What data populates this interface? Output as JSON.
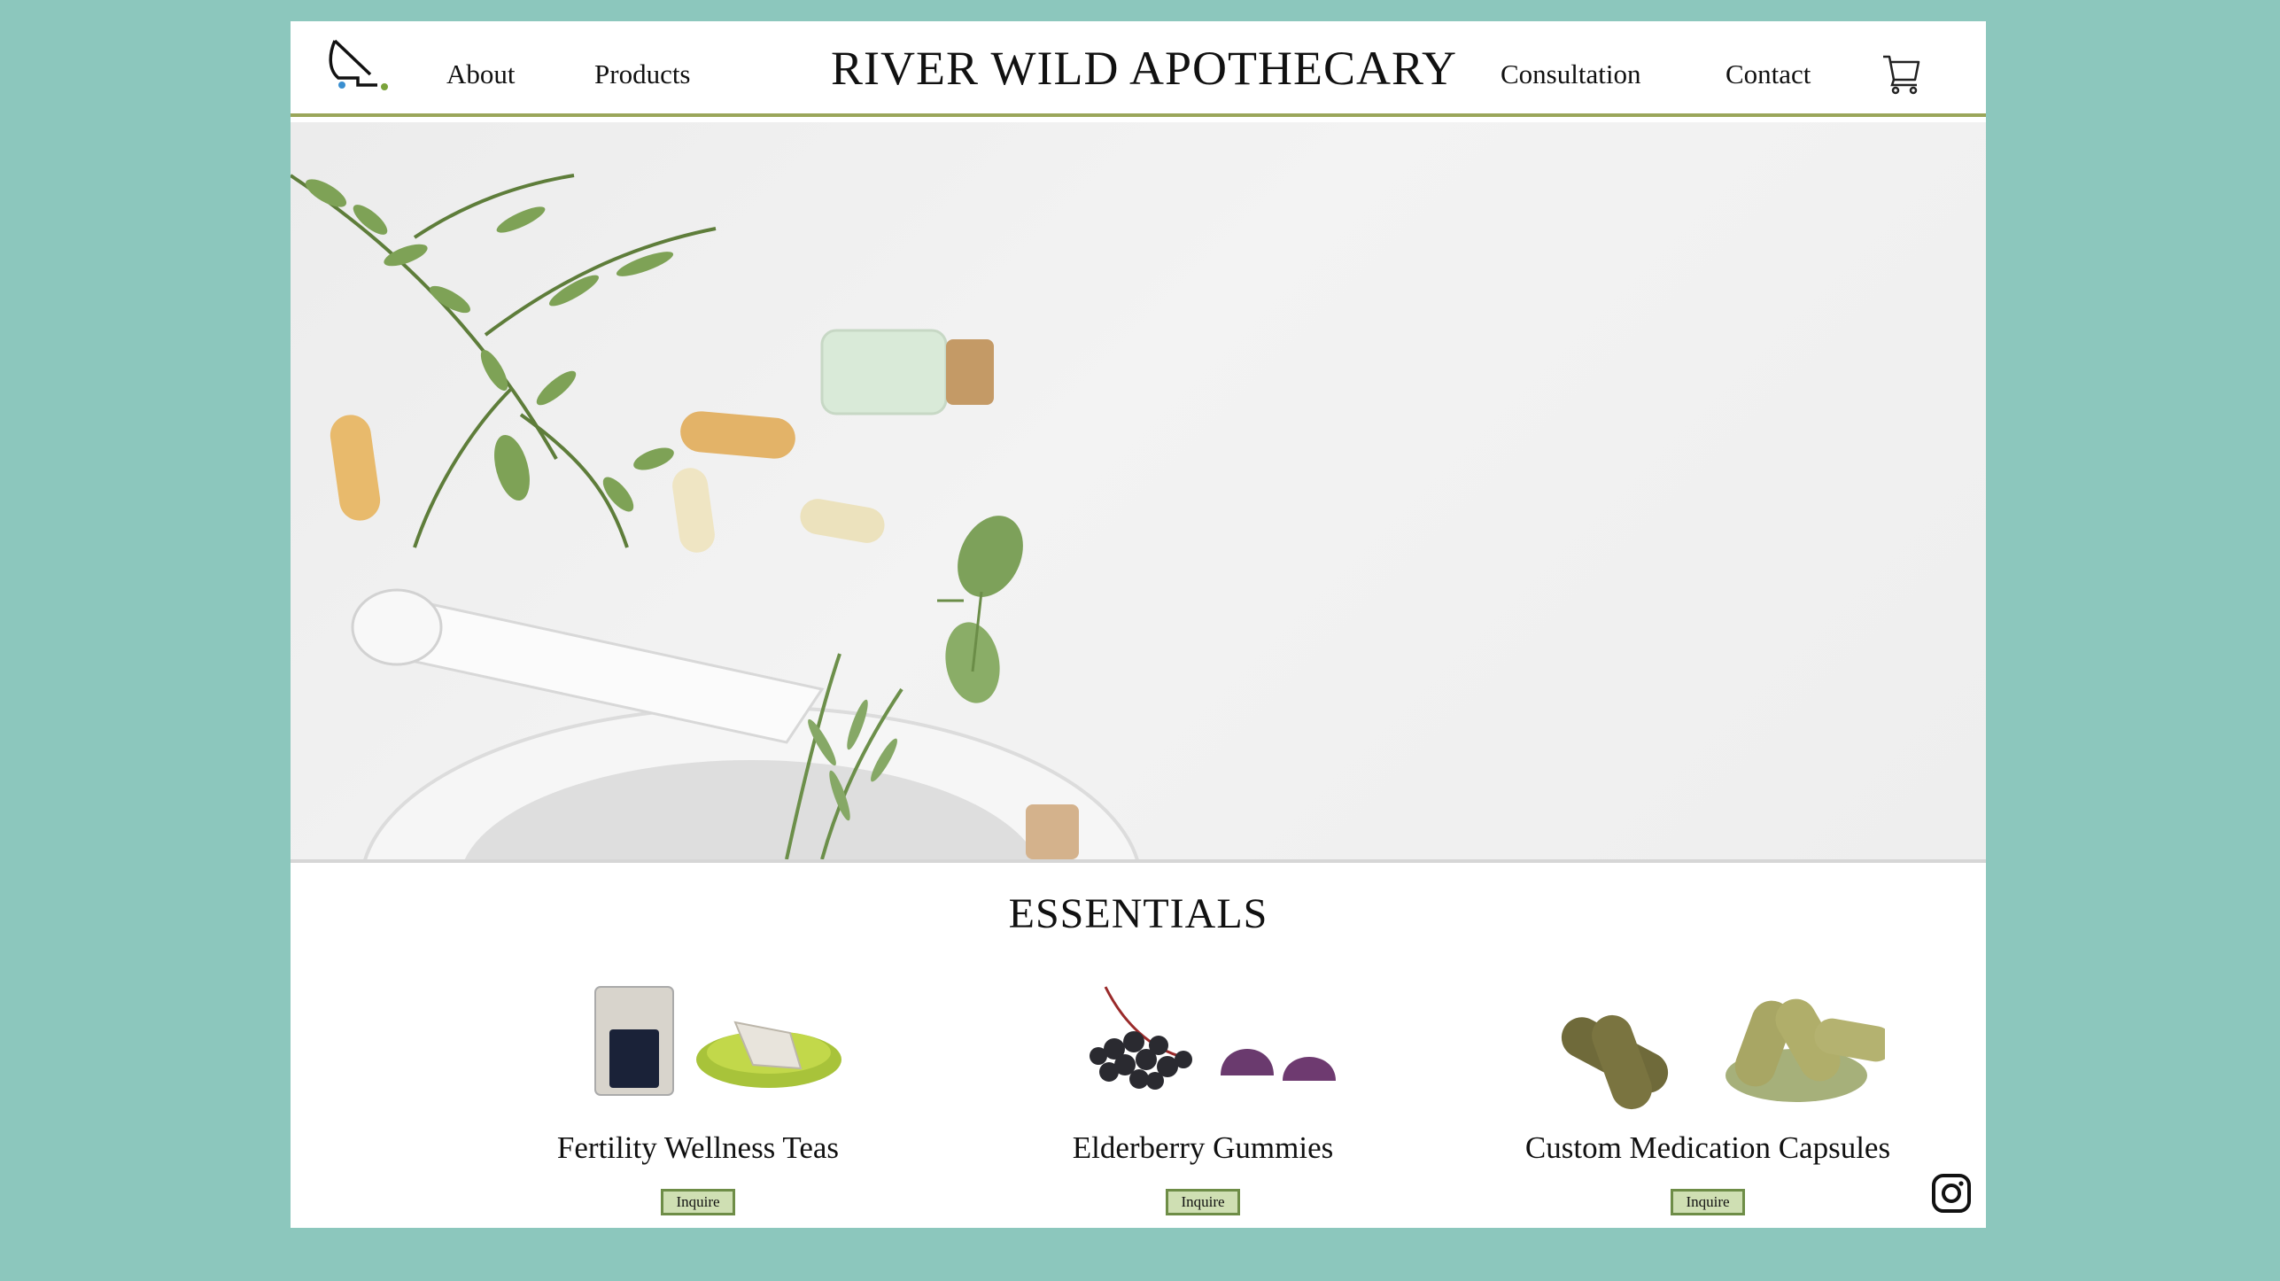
{
  "header": {
    "logo": "apothecary-logo",
    "nav_left": [
      "About",
      "Products"
    ],
    "brand": "RIVER WILD APOTHECARY",
    "nav_right": [
      "Consultation",
      "Contact"
    ],
    "cart_icon": "shopping-cart-icon"
  },
  "hero": {
    "image": "herbs-capsules-mortar-pestle-photo"
  },
  "essentials": {
    "title": "ESSENTIALS",
    "products": [
      {
        "name": "Fertility Wellness Teas",
        "button": "Inquire",
        "image": "tea-bag-and-bowl"
      },
      {
        "name": "Elderberry Gummies",
        "button": "Inquire",
        "image": "elderberries-and-gummies"
      },
      {
        "name": "Custom  Medication Capsules",
        "button": "Inquire",
        "image": "herbal-capsules-and-powder"
      }
    ]
  },
  "footer": {
    "social_icon": "instagram-icon"
  },
  "colors": {
    "background": "#8cc7bd",
    "accent_line": "#9aa65a",
    "button_fill": "#cfdfb3",
    "button_border": "#6e8d47"
  }
}
